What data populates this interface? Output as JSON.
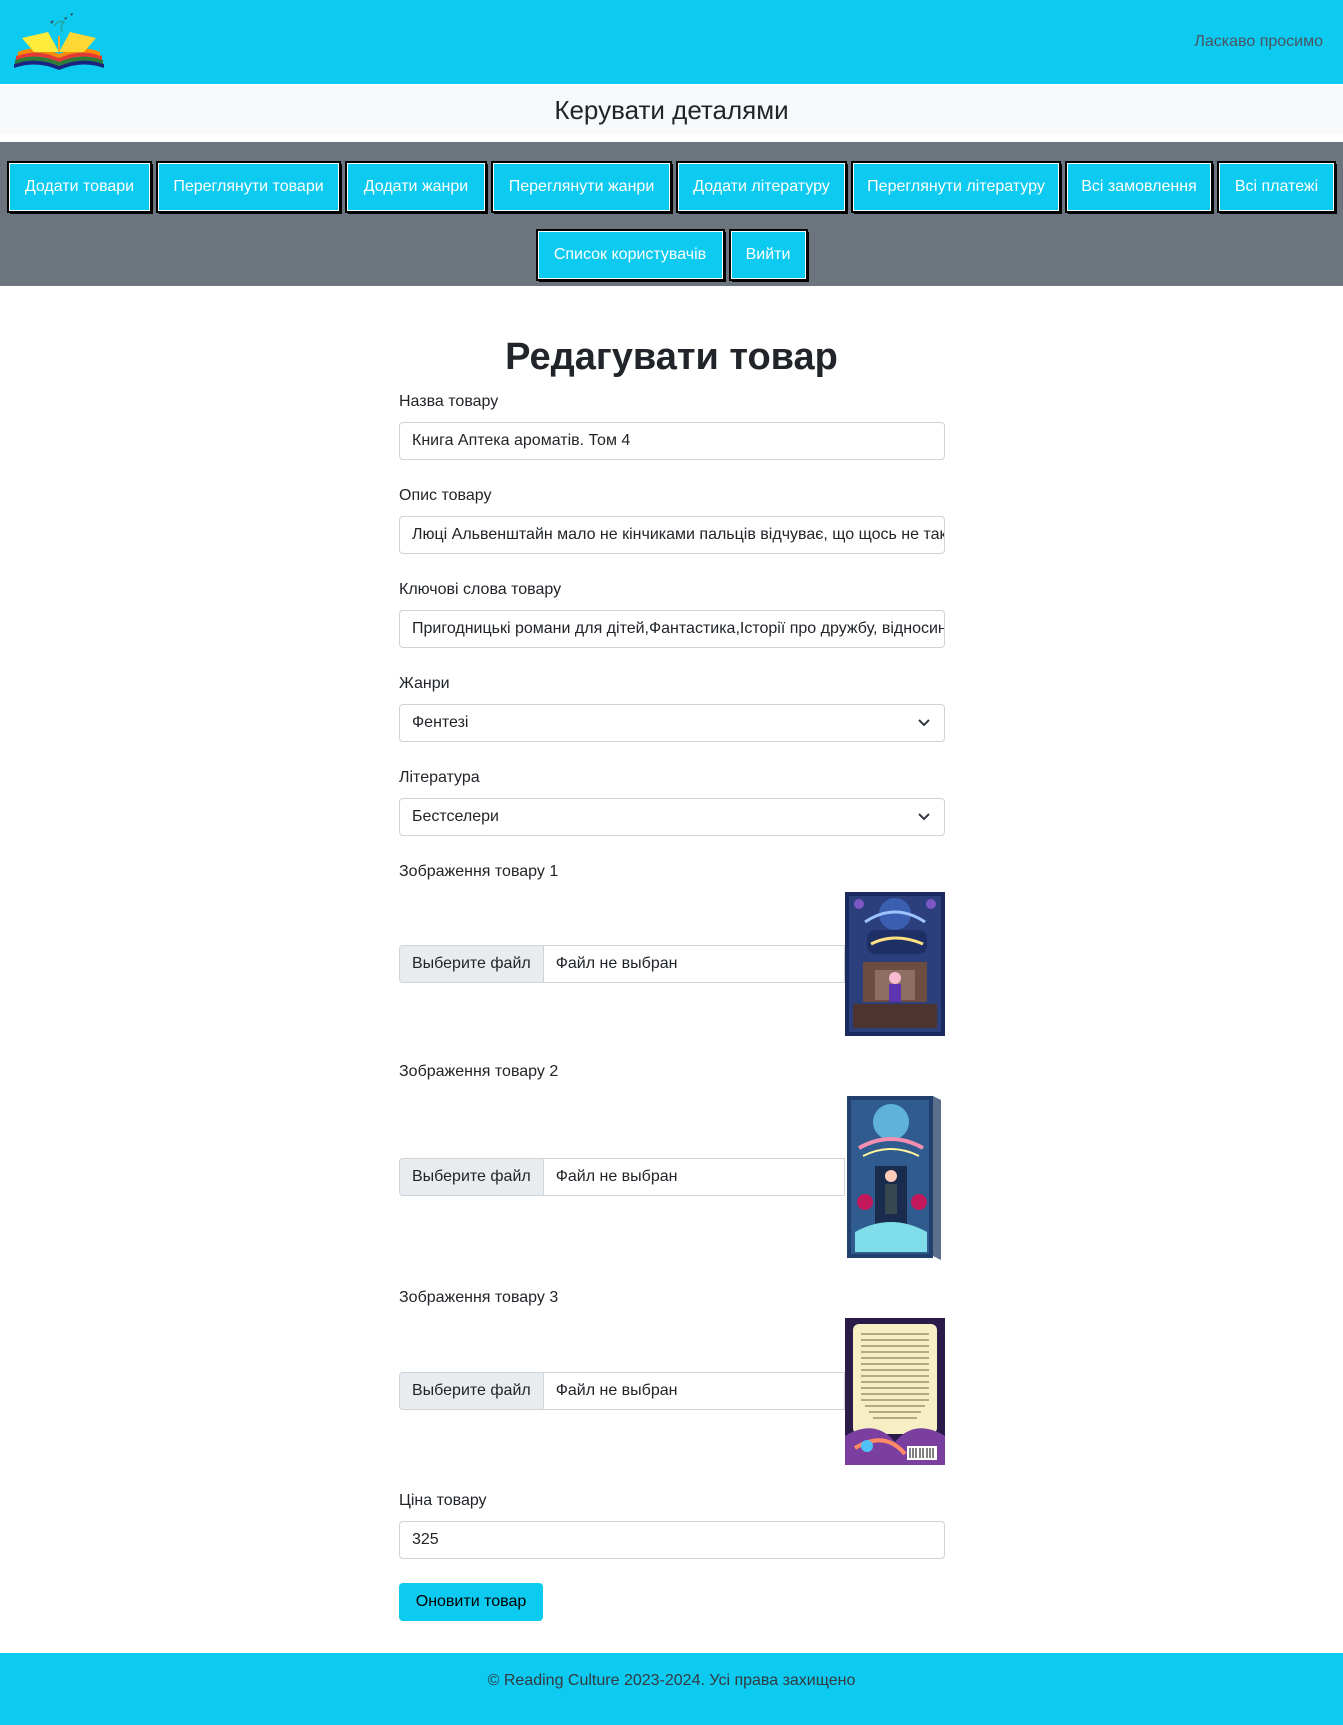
{
  "header": {
    "welcome": "Ласкаво просимо"
  },
  "subheader": {
    "title": "Керувати деталями"
  },
  "nav": {
    "row1": [
      "Додати товари",
      "Переглянути товари",
      "Додати жанри",
      "Переглянути жанри",
      "Додати літературу",
      "Переглянути літературу",
      "Всі замовлення",
      "Всі платежі"
    ],
    "row2": [
      "Список користувачів",
      "Вийти"
    ]
  },
  "form": {
    "title": "Редагувати товар",
    "name": {
      "label": "Назва товару",
      "value": "Книга Аптека ароматів. Том 4"
    },
    "description": {
      "label": "Опис товару",
      "value": "Люці Альвенштайн мало не кінчиками пальців відчуває, що щось не так"
    },
    "keywords": {
      "label": "Ключові слова товару",
      "value": "Пригодницькі романи для дітей,Фантастика,Історії про дружбу, відносини"
    },
    "genre": {
      "label": "Жанри",
      "value": "Фентезі"
    },
    "literature": {
      "label": "Література",
      "value": "Бестселери"
    },
    "images": [
      {
        "label": "Зображення товару 1",
        "button": "Выберите файл",
        "file": "Файл не выбран"
      },
      {
        "label": "Зображення товару 2",
        "button": "Выберите файл",
        "file": "Файл не выбран"
      },
      {
        "label": "Зображення товару 3",
        "button": "Выберите файл",
        "file": "Файл не выбран"
      }
    ],
    "price": {
      "label": "Ціна товару",
      "value": "325"
    },
    "submit": "Оновити товар"
  },
  "footer": {
    "text": "© Reading Culture 2023-2024. Усі права захищено"
  },
  "colors": {
    "accent": "#0dcaf0",
    "navbar": "#6c757d"
  }
}
